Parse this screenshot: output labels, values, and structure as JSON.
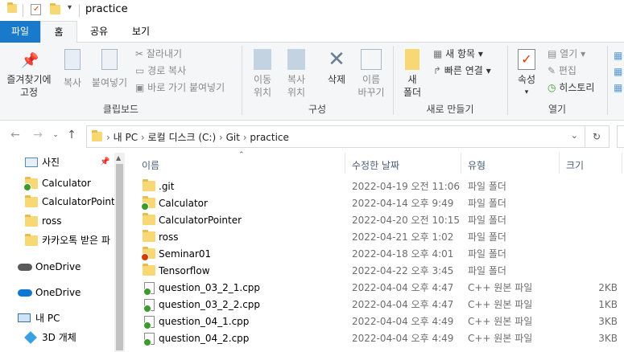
{
  "title": "practice",
  "tabs": [
    "파일",
    "홈",
    "공유",
    "보기"
  ],
  "ribbon": {
    "pin_label": "즐겨찾기에\n고정",
    "copy": "복사",
    "paste": "붙여넣기",
    "cut": "잘라내기",
    "copy_path": "경로 복사",
    "paste_shortcut": "바로 가기 붙여넣기",
    "group_clipboard": "클립보드",
    "move": "이동\n위치",
    "copyto": "복사\n위치",
    "delete": "삭제",
    "rename": "이름\n바꾸기",
    "group_organize": "구성",
    "new_folder": "새\n폴더",
    "new_item": "새 항목",
    "easy_access": "빠른 연결",
    "group_new": "새로 만들기",
    "properties": "속성",
    "open": "열기",
    "edit": "편집",
    "history": "히스토리",
    "group_open": "열기"
  },
  "breadcrumb": [
    "내 PC",
    "로컬 디스크 (C:)",
    "Git",
    "practice"
  ],
  "nav": [
    {
      "label": "사진",
      "icon": "photo-icon"
    },
    {
      "label": "Calculator",
      "icon": "folder-check-icon"
    },
    {
      "label": "CalculatorPointer",
      "icon": "folder-icon"
    },
    {
      "label": "ross",
      "icon": "folder-icon"
    },
    {
      "label": "카카오톡 받은 파",
      "icon": "folder-icon"
    },
    {
      "label": "OneDrive",
      "icon": "onedrive-icon"
    },
    {
      "label": "OneDrive",
      "icon": "onedrive-icon"
    },
    {
      "label": "내 PC",
      "icon": "pc-icon"
    },
    {
      "label": "3D 개체",
      "icon": "3d-objects-icon"
    }
  ],
  "columns": {
    "name": "이름",
    "date": "수정한 날짜",
    "type": "유형",
    "size": "크기"
  },
  "files": [
    {
      "name": ".git",
      "date": "2022-04-19 오전 11:06",
      "type": "파일 폴더",
      "size": "",
      "icon": "folder"
    },
    {
      "name": "Calculator",
      "date": "2022-04-14 오후 9:49",
      "type": "파일 폴더",
      "size": "",
      "icon": "folder-check"
    },
    {
      "name": "CalculatorPointer",
      "date": "2022-04-20 오전 10:15",
      "type": "파일 폴더",
      "size": "",
      "icon": "folder"
    },
    {
      "name": "ross",
      "date": "2022-04-21 오후 1:02",
      "type": "파일 폴더",
      "size": "",
      "icon": "folder"
    },
    {
      "name": "Seminar01",
      "date": "2022-04-18 오후 4:01",
      "type": "파일 폴더",
      "size": "",
      "icon": "folder-error"
    },
    {
      "name": "Tensorflow",
      "date": "2022-04-22 오후 3:45",
      "type": "파일 폴더",
      "size": "",
      "icon": "folder"
    },
    {
      "name": "question_03_2_1.cpp",
      "date": "2022-04-04 오후 4:47",
      "type": "C++ 원본 파일",
      "size": "2KB",
      "icon": "doc-check"
    },
    {
      "name": "question_03_2_2.cpp",
      "date": "2022-04-04 오후 4:47",
      "type": "C++ 원본 파일",
      "size": "1KB",
      "icon": "doc-check"
    },
    {
      "name": "question_04_1.cpp",
      "date": "2022-04-04 오후 4:49",
      "type": "C++ 원본 파일",
      "size": "3KB",
      "icon": "doc-check"
    },
    {
      "name": "question_04_2.cpp",
      "date": "2022-04-04 오후 4:49",
      "type": "C++ 원본 파일",
      "size": "3KB",
      "icon": "doc-check"
    }
  ],
  "colors": {
    "file_tab": "#1979ca",
    "check": "#3c9a2e",
    "error": "#d83b01",
    "folder": "#f8d775"
  }
}
